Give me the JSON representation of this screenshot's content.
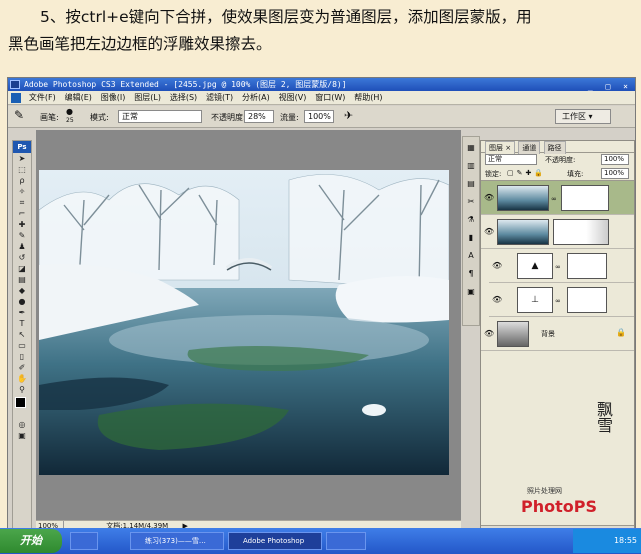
{
  "caption": {
    "line1": "5、按ctrl+e键向下合拼，使效果图层变为普通图层，添加图层蒙版，用",
    "line2": "黑色画笔把左边边框的浮雕效果擦去。"
  },
  "window": {
    "title": "Adobe Photoshop CS3 Extended - [2455.jpg @ 100% (图层 2, 图层蒙版/8)]",
    "controls": "_ □ ×"
  },
  "menu": [
    "文件(F)",
    "编辑(E)",
    "图像(I)",
    "图层(L)",
    "选择(S)",
    "滤镜(T)",
    "分析(A)",
    "视图(V)",
    "窗口(W)",
    "帮助(H)"
  ],
  "options": {
    "brush_label": "画笔:",
    "brush_size": "25",
    "mode_label": "模式:",
    "mode_value": "正常",
    "opacity_label": "不透明度:",
    "opacity_value": "28%",
    "flow_label": "流量:",
    "flow_value": "100%",
    "workspace": "工作区 ▾"
  },
  "statusbar": {
    "zoom": "100%",
    "doc": "文档:1.14M/4.39M"
  },
  "layers_panel": {
    "tabs": [
      "图层 ×",
      "通道",
      "路径"
    ],
    "blend_mode": "正常",
    "opacity_label": "不透明度:",
    "opacity_value": "100%",
    "lock_label": "锁定:",
    "fill_label": "填充:",
    "fill_value": "100%",
    "background_name": "背景"
  },
  "watermark": {
    "site": "照片处理网",
    "logo": "PhotoPS"
  },
  "taskbar": {
    "start": "开始",
    "items": [
      "练习(373)——雪…",
      "Adobe Photoshop",
      ""
    ],
    "clock": "18:55"
  },
  "colors": {
    "accent": "#3c78d8",
    "selected_layer": "#a8b98a",
    "logo_red": "#d0202a",
    "logo_blue": "#1a55c0"
  }
}
